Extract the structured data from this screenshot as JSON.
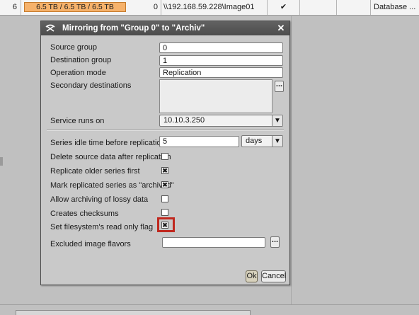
{
  "background_table": {
    "row_number": "6",
    "storage_bar": "6.5 TB / 6.5 TB / 6.5 TB",
    "count": "0",
    "path": "\\\\192.168.59.228\\Image01",
    "type_text": "Database ..."
  },
  "dialog": {
    "title": "Mirroring from \"Group 0\" to \"Archiv\"",
    "source_group": {
      "label": "Source group",
      "value": "0"
    },
    "destination_group": {
      "label": "Destination group",
      "value": "1"
    },
    "operation_mode": {
      "label": "Operation mode",
      "value": "Replication"
    },
    "secondary_destinations": {
      "label": "Secondary destinations"
    },
    "service_runs_on": {
      "label": "Service runs on",
      "value": "10.10.3.250"
    },
    "idle_time": {
      "label": "Series idle time before replication",
      "value": "5",
      "unit": "days"
    },
    "checkboxes": [
      {
        "label": "Delete source data after replication",
        "checked": false
      },
      {
        "label": "Replicate older series first",
        "checked": true
      },
      {
        "label": "Mark replicated series as \"archived\"",
        "checked": true
      },
      {
        "label": "Allow archiving of lossy data",
        "checked": false
      },
      {
        "label": "Creates checksums",
        "checked": false
      },
      {
        "label": "Set filesystem's read only flag",
        "checked": true
      }
    ],
    "excluded_flavors": {
      "label": "Excluded image flavors",
      "value": ""
    },
    "ok_label": "Ok",
    "cancel_label": "Cancel",
    "more_button": "..."
  },
  "colors": {
    "title_bar": "#555555",
    "highlight": "#c0281e",
    "storage_bar": "#f6b26b"
  }
}
